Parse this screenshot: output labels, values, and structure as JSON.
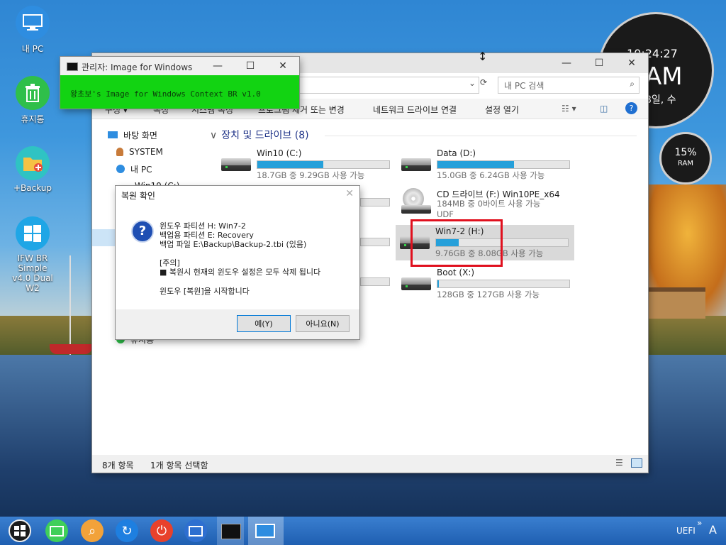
{
  "desktop": {
    "icons": [
      {
        "label": "내 PC",
        "icon": "monitor-icon"
      },
      {
        "label": "휴지통",
        "icon": "recycle-bin-icon"
      },
      {
        "label": "+Backup",
        "icon": "folder-plus-icon"
      },
      {
        "label": "IFW BR Simple",
        "label2": "v4.0 Dual W2",
        "icon": "windows-logo-icon"
      }
    ]
  },
  "clock_widget": {
    "time": "10:24:27",
    "big": "AM",
    "date": "8일, 수"
  },
  "ram_widget": {
    "percent": "15%",
    "label": "RAM"
  },
  "console_window": {
    "title": "관리자:  Image for Windows",
    "text": "왕초보's Image for Windows Context BR v1.0"
  },
  "explorer": {
    "search_placeholder": "내 PC 검색",
    "ribbon": [
      "구성 ▾",
      "속성",
      "시스템 속성",
      "프로그램 제거 또는 변경",
      "네트워크 드라이브 연결",
      "설정 열기"
    ],
    "nav": [
      "바탕 화면",
      "SYSTEM",
      "내 PC",
      "Win10 (C:)",
      "휴지통"
    ],
    "group_header": "장치 및 드라이브 (8)",
    "drives": [
      {
        "name": "Win10 (C:)",
        "sub": "18.7GB 중 9.29GB 사용 가능",
        "used": 0.5,
        "type": "hdd"
      },
      {
        "name": "Data (D:)",
        "sub": "15.0GB 중 6.24GB 사용 가능",
        "used": 0.58,
        "type": "hdd"
      },
      {
        "name": "CD 드라이브 (F:) Win10PE_x64",
        "sub": "184MB 중 0바이트 사용 가능",
        "sub2": "UDF",
        "used": 1.0,
        "type": "cd"
      },
      {
        "name": "Win7-2 (H:)",
        "sub": "9.76GB 중 8.08GB 사용 가능",
        "used": 0.17,
        "type": "hdd"
      },
      {
        "name": "Boot (X:)",
        "sub": "128GB 중 127GB 사용 가능",
        "used": 0.01,
        "type": "hdd"
      }
    ],
    "status": {
      "count": "8개 항목",
      "selected": "1개 항목 선택함"
    }
  },
  "dialog": {
    "title": "복원 확인",
    "lines": [
      "윈도우 파티션 H:  Win7-2",
      "백업용 파티션 E:  Recovery",
      "백업 파일 E:\\Backup\\Backup-2.tbi  (있음)",
      "[주의]",
      "■ 복원시 현재의 윈도우 설정은 모두 삭제 됩니다",
      "윈도우 [복원]을 시작합니다"
    ],
    "yes": "예(Y)",
    "no": "아니요(N)"
  },
  "taskbar": {
    "uefi_label": "UEFI",
    "chevron": "»",
    "ime": "A"
  }
}
